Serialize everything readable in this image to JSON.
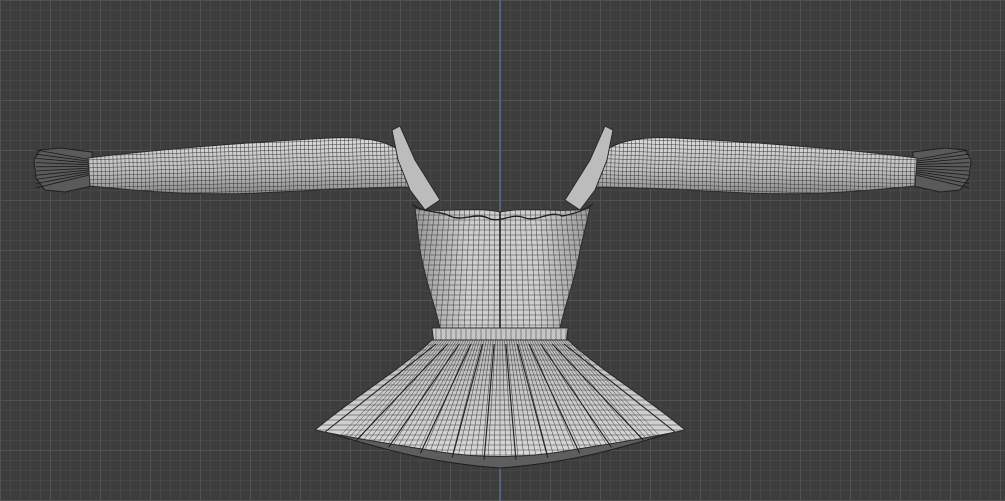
{
  "viewport": {
    "background_color": "#3d3d3d",
    "grid_minor_color": "#474747",
    "grid_major_color": "#525252",
    "axis_color": "#5a7fb0",
    "mesh_fill_color": "#c8c8c8",
    "mesh_shade_color": "#a9a9a9",
    "wire_color": "#2a2a2a"
  },
  "model": {
    "type": "garment-mesh",
    "description_icon": "dress-wireframe-icon"
  }
}
